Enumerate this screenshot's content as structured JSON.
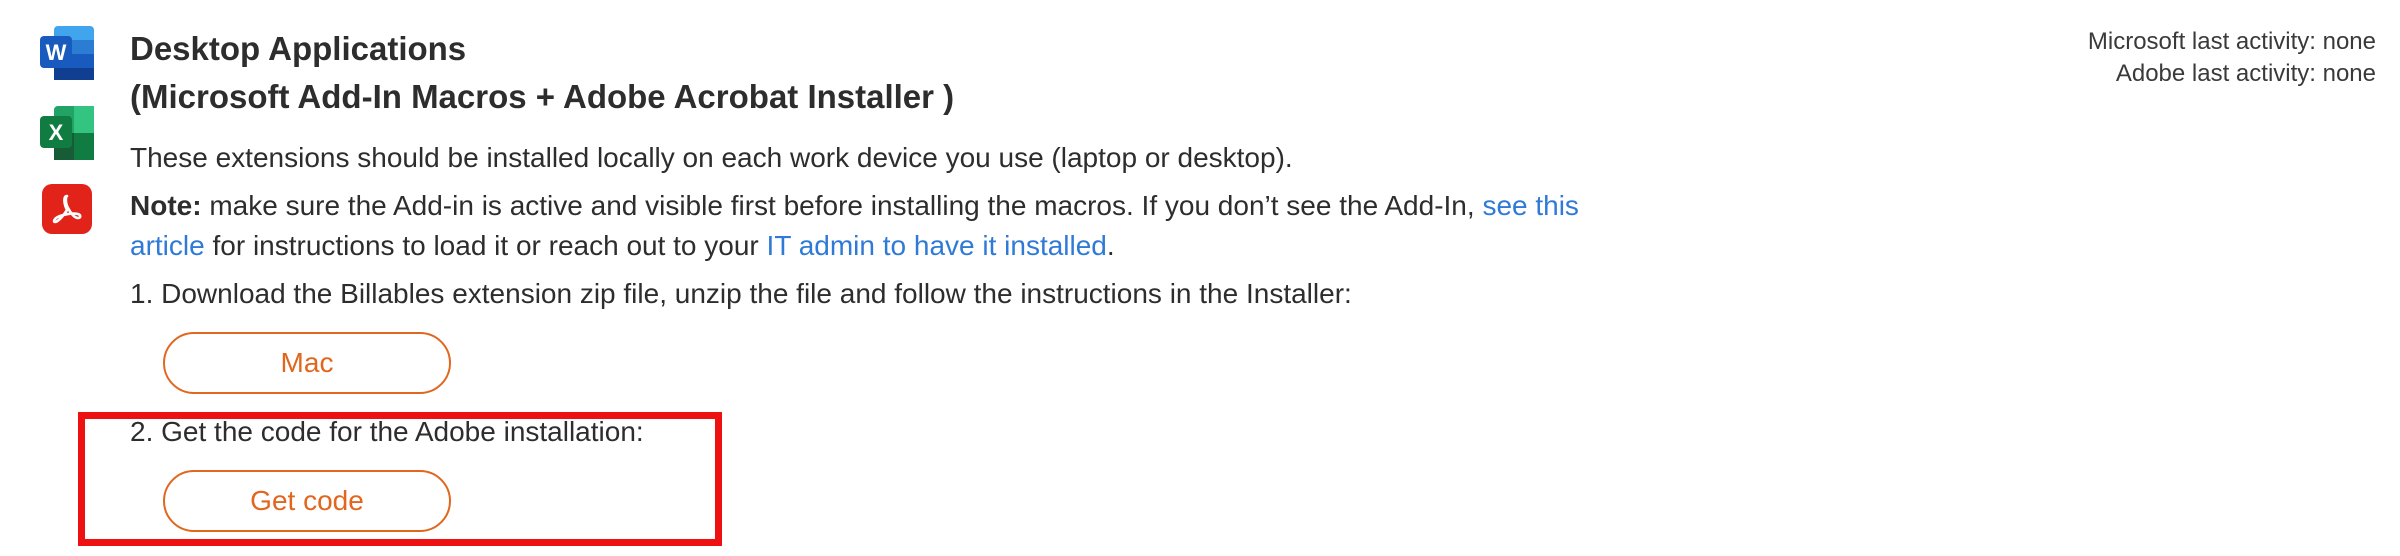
{
  "section": {
    "title_line1": "Desktop Applications",
    "title_line2": "(Microsoft Add-In Macros + Adobe Acrobat Installer )",
    "icons": {
      "word": {
        "name": "word-icon",
        "letter": "W",
        "color": "#185abd"
      },
      "excel": {
        "name": "excel-icon",
        "letter": "X",
        "color": "#107c41"
      },
      "acrobat": {
        "name": "acrobat-icon",
        "color": "#e2231a"
      }
    }
  },
  "activity": {
    "microsoft": "Microsoft last activity: none",
    "adobe": "Adobe last activity: none"
  },
  "content": {
    "intro": "These extensions should be installed locally on each work device you use (laptop or desktop).",
    "note_label": "Note:",
    "note_text_1": " make sure the Add-in is active and visible first before installing the macros. If you don’t see the Add-In, ",
    "note_link_1a": "see this",
    "note_link_1b": "article",
    "note_text_2": " for instructions to load it or reach out to your ",
    "note_link_2": "IT admin to have it installed",
    "note_text_3": ".",
    "step1": "1. Download the Billables extension zip file, unzip the file and follow the instructions in the Installer:",
    "step2": "2. Get the code for the Adobe installation:"
  },
  "buttons": {
    "mac": "Mac",
    "get_code": "Get code"
  },
  "colors": {
    "accent": "#e0671d",
    "link": "#2f7ad6",
    "highlight": "#ee1111"
  }
}
